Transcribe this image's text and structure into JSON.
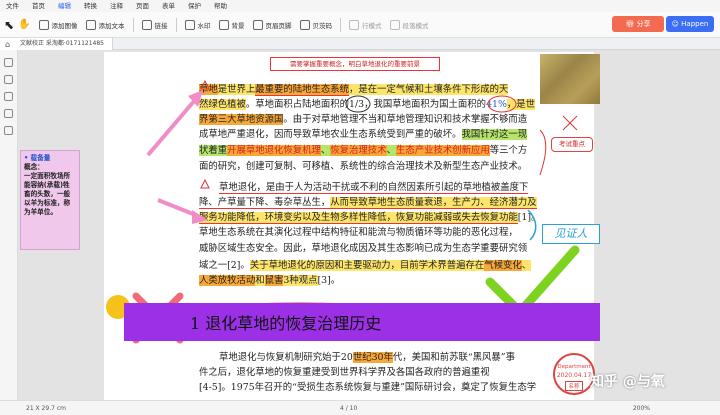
{
  "menu": [
    "文件",
    "首页",
    "编辑",
    "转换",
    "注释",
    "页面",
    "表单",
    "保护",
    "帮助"
  ],
  "menu_active": "编辑",
  "toolbar": {
    "add_image": "添加图像",
    "add_text": "添加文本",
    "link": "链接",
    "watermark": "水印",
    "background": "背景",
    "header_footer": "页眉页脚",
    "bates": "贝茨码",
    "line_number": "行模式",
    "paragraph_mode": "段落模式"
  },
  "share_label": "分享",
  "user_label": "Happen",
  "tab_label": "文献校正 采淘都·0171121485",
  "note_box": "需要掌握重要概念，明白草地退化的重要前景",
  "sticky": {
    "title": "• 载备量",
    "sub": "概念：",
    "body": "一定面积牧场所能容纳(承载)牲畜的头数，一般以羊为标准，称为羊单位。"
  },
  "callout": "考试重点",
  "witness": "见证人",
  "text_lines": [
    {
      "segments": [
        {
          "t": "草地",
          "c": "hl-o"
        },
        {
          "t": "是世界上",
          "c": "hl-y"
        },
        {
          "t": "最重要的陆地生态系统",
          "c": "hl-o ul-r"
        },
        {
          "t": "，是在一定气候和土壤条件下形成的天",
          "c": "hl-y"
        }
      ]
    },
    {
      "segments": [
        {
          "t": "然绿色植被",
          "c": "hl-y"
        },
        {
          "t": "。草地面积占陆地面积的",
          "c": ""
        },
        {
          "t": "1/3",
          "c": ""
        },
        {
          "t": "，我国草地面积为国土面积的",
          "c": ""
        },
        {
          "t": "41%",
          "c": "blue"
        },
        {
          "t": "，是世",
          "c": "hl-y"
        }
      ]
    },
    {
      "segments": [
        {
          "t": "界第三大草地资源国",
          "c": "hl-o"
        },
        {
          "t": "。由于对草地管理不当和草地管理知识和技术掌握不够而造",
          "c": ""
        }
      ]
    },
    {
      "segments": [
        {
          "t": "成草地严重退化，因而导致草地农业生态系统受到严重的破坏。",
          "c": ""
        },
        {
          "t": "我国针对这一现",
          "c": "hl-g"
        }
      ]
    },
    {
      "segments": [
        {
          "t": "状着重",
          "c": "hl-g"
        },
        {
          "t": "开展草地退化恢复机理",
          "c": "hl-o red"
        },
        {
          "t": "、",
          "c": "hl-g"
        },
        {
          "t": "恢复治理技术",
          "c": "hl-o red"
        },
        {
          "t": "、",
          "c": "hl-g"
        },
        {
          "t": "生态产业技术创新应用",
          "c": "hl-o red"
        },
        {
          "t": "等三个方",
          "c": ""
        }
      ]
    },
    {
      "segments": [
        {
          "t": "面的研究，创建可复制、可移植、系统性的综合治理技术及新型生态产业技术。",
          "c": ""
        }
      ]
    },
    {
      "segments": [
        {
          "t": "草地退化，是由于人为活动干扰或不利的自然因素所引起的草地植被盖度下",
          "c": "ul-r"
        }
      ]
    },
    {
      "segments": [
        {
          "t": "降、产草量下降、毒杂草丛生，",
          "c": "ul-r"
        },
        {
          "t": "从而导致草地生态质量衰退，生产力、经济潜力及",
          "c": "hl-y ul-r"
        }
      ]
    },
    {
      "segments": [
        {
          "t": "服务功能降低，环境变劣以及生物多样性降低，恢复功能减弱或失去恢复功能",
          "c": "hl-y ul-r"
        },
        {
          "t": "[1]",
          "c": ""
        },
        {
          "t": "。",
          "c": ""
        }
      ]
    },
    {
      "segments": [
        {
          "t": "草地生态系统在其演化过程中结构特征和能流与物质循环等功能的恶化过程，",
          "c": ""
        }
      ]
    },
    {
      "segments": [
        {
          "t": "威胁区域生态安全。因此，草地退化成因及其生态影响已成为生态学重要研究领",
          "c": ""
        }
      ]
    },
    {
      "segments": [
        {
          "t": "域之一",
          "c": ""
        },
        {
          "t": "[2]",
          "c": ""
        },
        {
          "t": "。",
          "c": ""
        },
        {
          "t": "关于草地退化的原因和主要驱动力，目前学术界普遍存在",
          "c": "hl-y"
        },
        {
          "t": "气候变化",
          "c": "hl-o"
        },
        {
          "t": "、",
          "c": "hl-y"
        }
      ]
    },
    {
      "segments": [
        {
          "t": "人类放牧活动",
          "c": "hl-o"
        },
        {
          "t": "和",
          "c": "hl-y"
        },
        {
          "t": "鼠害",
          "c": "hl-o"
        },
        {
          "t": "3种观点",
          "c": "hl-y"
        },
        {
          "t": "[3]",
          "c": ""
        },
        {
          "t": "。",
          "c": ""
        }
      ]
    }
  ],
  "section_title": "1  退化草地的恢复治理历史",
  "tail_lines": [
    {
      "segments": [
        {
          "t": "草地退化与恢复机制研究始于20",
          "c": ""
        },
        {
          "t": "世纪30年",
          "c": "hl-o"
        },
        {
          "t": "代，美国和前苏联“黑风暴”事",
          "c": ""
        }
      ]
    },
    {
      "segments": [
        {
          "t": "件之后，退化草地的恢复重建受到世界科学界及各国各政府的普遍重视",
          "c": ""
        }
      ]
    },
    {
      "segments": [
        {
          "t": "[4-5]",
          "c": ""
        },
        {
          "t": "。1975年召开的“受损生态系统恢复与重建”国际研讨会，奠定了恢复生态学",
          "c": ""
        }
      ]
    }
  ],
  "stamp": {
    "top": "Department",
    "date": "2020.04.17",
    "name": "名称"
  },
  "watermark": "知乎 @与氧",
  "status": {
    "size": "21 X 29.7 cm",
    "page": "4 / 10",
    "zoom": "200%"
  }
}
